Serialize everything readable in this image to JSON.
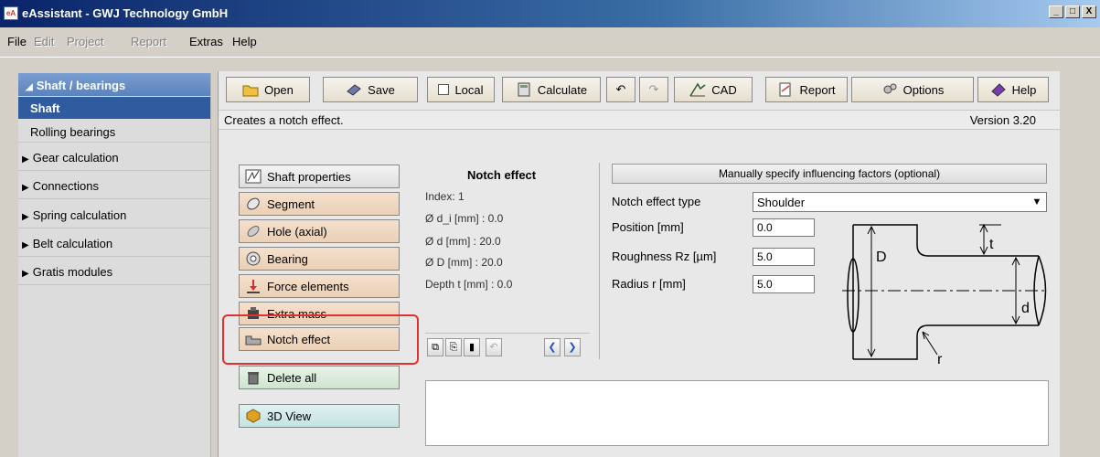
{
  "window": {
    "title": "eAssistant - GWJ Technology GmbH",
    "icon_text": "eA",
    "controls": [
      "_",
      "□",
      "X"
    ]
  },
  "menu": {
    "items": [
      {
        "label": "File",
        "enabled": true
      },
      {
        "label": "Edit",
        "enabled": false
      },
      {
        "label": "Project",
        "enabled": false
      },
      {
        "label": "Report",
        "enabled": false
      },
      {
        "label": "Extras",
        "enabled": true
      },
      {
        "label": "Help",
        "enabled": true
      }
    ]
  },
  "sidebar": {
    "header": "Shaft / bearings",
    "active_item": "Shaft",
    "sub_items": [
      "Rolling bearings"
    ],
    "groups": [
      "Gear calculation",
      "Connections",
      "Spring calculation",
      "Belt calculation",
      "Gratis modules"
    ]
  },
  "toolbar": {
    "open": "Open",
    "save": "Save",
    "local": "Local",
    "calculate": "Calculate",
    "cad": "CAD",
    "report": "Report",
    "options": "Options",
    "help": "Help"
  },
  "status": {
    "message": "Creates a notch effect.",
    "version": "Version 3.20"
  },
  "elements": {
    "shaft_properties": "Shaft properties",
    "segment": "Segment",
    "hole_axial": "Hole (axial)",
    "bearing": "Bearing",
    "force_elements": "Force elements",
    "extra_mass": "Extra mass",
    "notch_effect": "Notch effect",
    "delete_all": "Delete all",
    "view_3d": "3D View"
  },
  "notch_info": {
    "title": "Notch effect",
    "index": "Index: 1",
    "d_i": "Ø d_i [mm] : 0.0",
    "d": "Ø d [mm] : 20.0",
    "D": "Ø D [mm] : 20.0",
    "depth": "Depth t [mm] : 0.0"
  },
  "influence": {
    "header": "Manually specify influencing factors (optional)",
    "type_label": "Notch effect type",
    "type_value": "Shoulder",
    "position_label": "Position [mm]",
    "position_value": "0.0",
    "roughness_label": "Roughness Rz [µm]",
    "roughness_value": "5.0",
    "radius_label": "Radius r [mm]",
    "radius_value": "5.0"
  },
  "diagram": {
    "label_D": "D",
    "label_d": "d",
    "label_t": "t",
    "label_r": "r"
  },
  "colors": {
    "title_start": "#0a246a",
    "sidebar_active": "#2f5c9f",
    "highlight": "#e03030"
  }
}
